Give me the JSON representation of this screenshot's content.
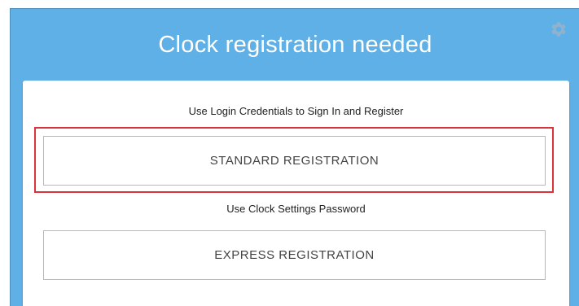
{
  "header": {
    "title": "Clock registration needed",
    "settings_icon": "gear-icon"
  },
  "card": {
    "standard_hint": "Use Login Credentials to Sign In and Register",
    "standard_button": "STANDARD REGISTRATION",
    "express_hint": "Use Clock Settings Password",
    "express_button": "EXPRESS REGISTRATION"
  },
  "colors": {
    "header_background": "#5fb0e6",
    "highlight_border": "#d9343a"
  }
}
